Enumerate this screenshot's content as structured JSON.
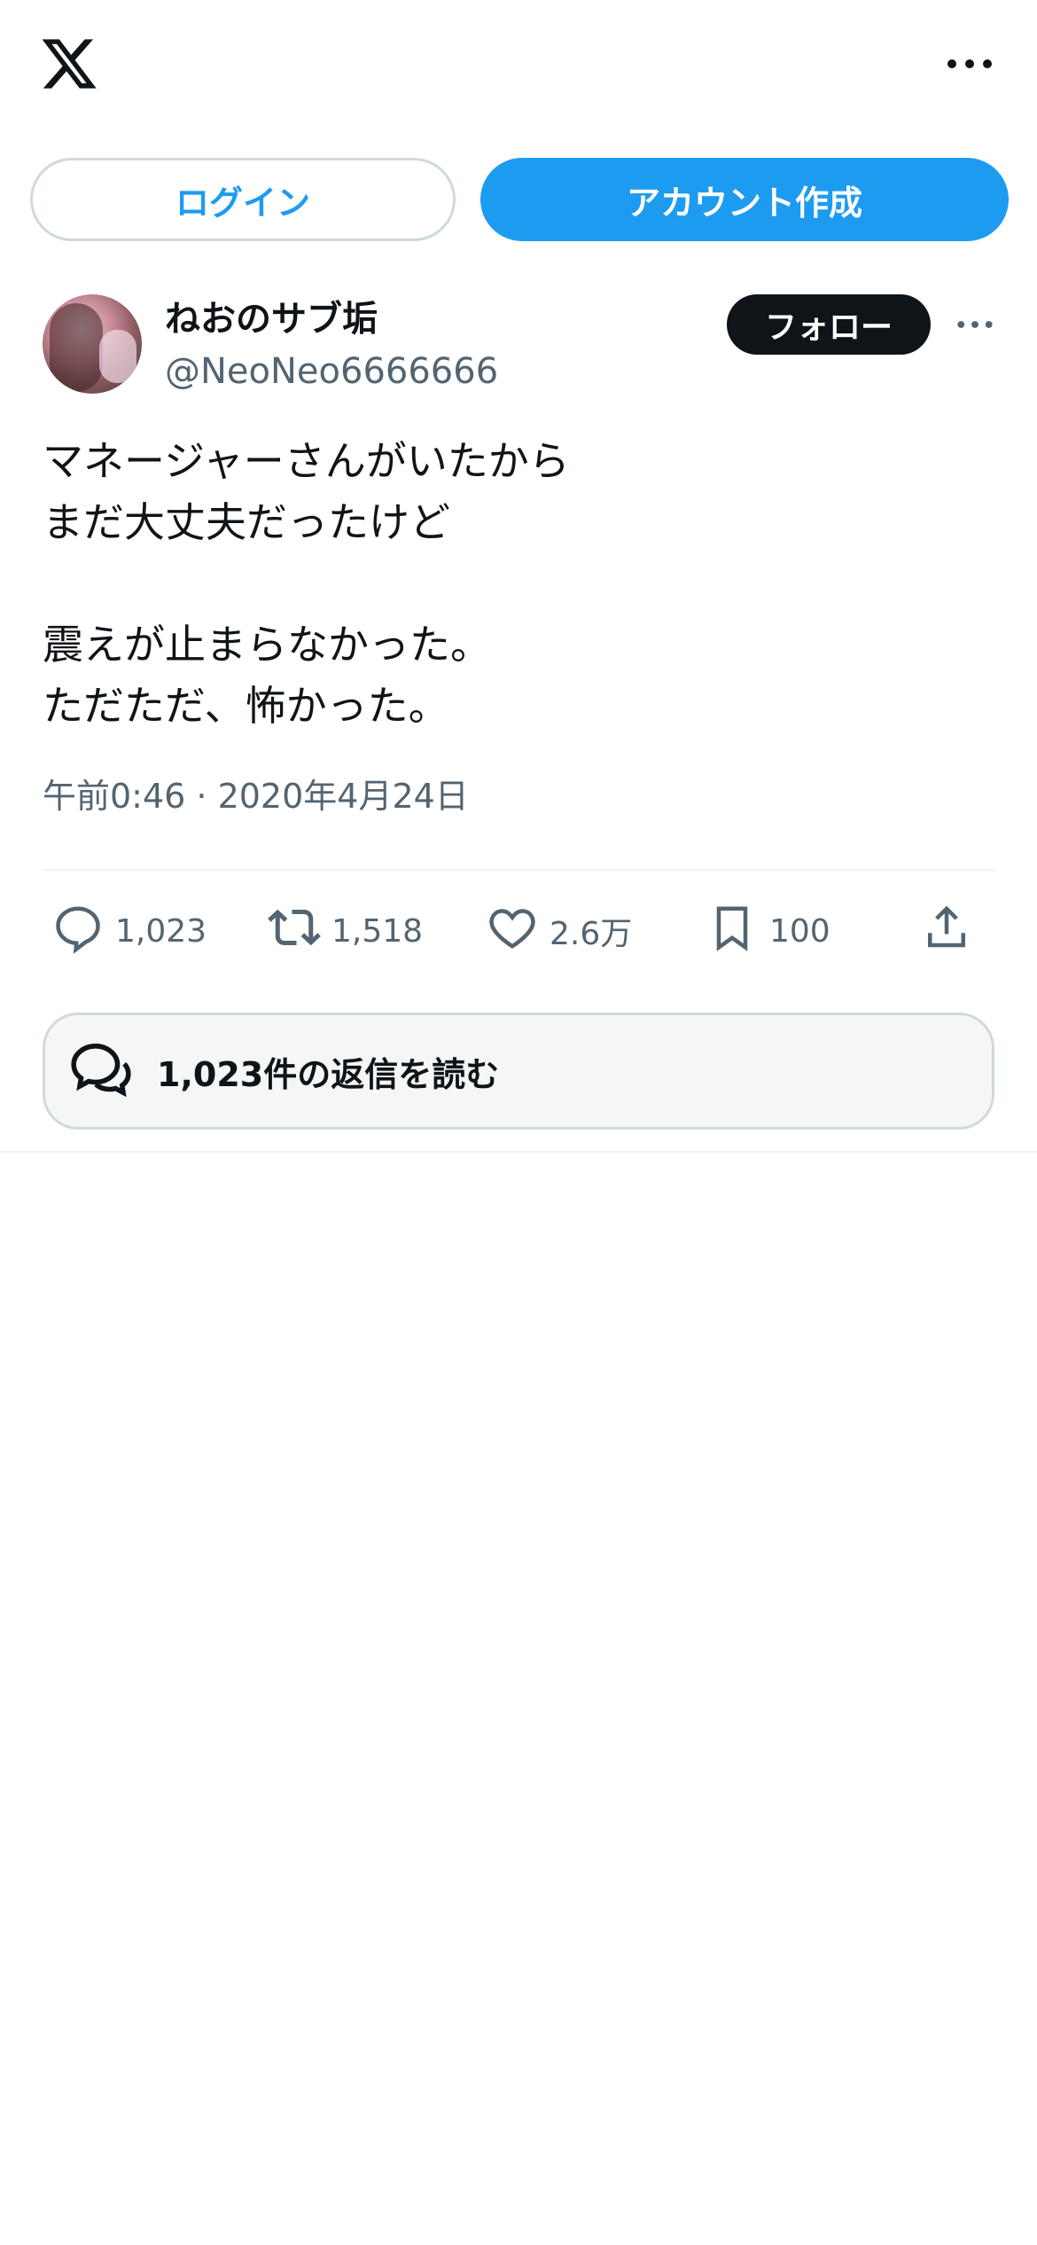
{
  "header": {
    "logo_icon": "x-logo-icon",
    "more_icon": "more-horizontal-icon"
  },
  "auth": {
    "login_label": "ログイン",
    "signup_label": "アカウント作成"
  },
  "tweet": {
    "author": {
      "display_name": "ねおのサブ垢",
      "handle": "@NeoNeo6666666"
    },
    "follow_label": "フォロー",
    "text": "マネージャーさんがいたから\nまだ大丈夫だったけど\n\n震えが止まらなかった。\nただただ、怖かった。",
    "timestamp": "午前0:46 · 2020年4月24日",
    "stats": {
      "replies": "1,023",
      "retweets": "1,518",
      "likes": "2.6万",
      "bookmarks": "100"
    },
    "read_replies_label": "1,023件の返信を読む"
  },
  "colors": {
    "accent": "#1d9bf0",
    "text_primary": "#0f1419",
    "text_secondary": "#536471",
    "border": "#cfd9de"
  }
}
